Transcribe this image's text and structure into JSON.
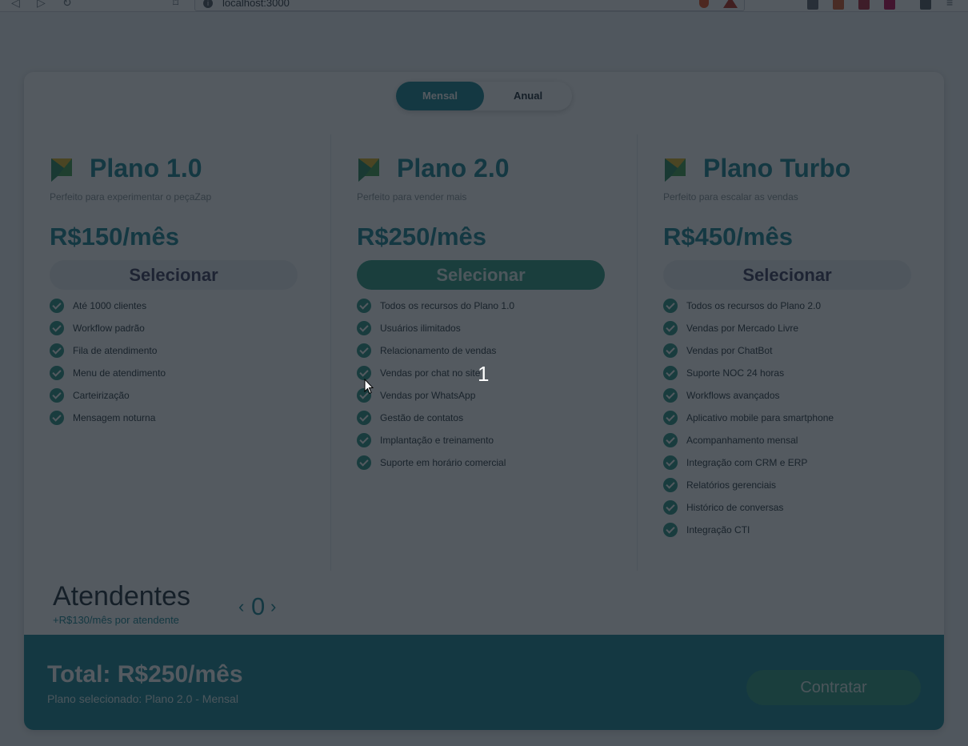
{
  "browser": {
    "url": "localhost:3000"
  },
  "billing_toggle": {
    "monthly_label": "Mensal",
    "annual_label": "Anual",
    "active": "Mensal"
  },
  "select_label": "Selecionar",
  "plans": [
    {
      "name": "Plano 1.0",
      "subtitle": "Perfeito para experimentar o peçaZap",
      "price": "R$150/mês",
      "selected": false,
      "features": [
        "Até 1000 clientes",
        "Workflow padrão",
        "Fila de atendimento",
        "Menu de atendimento",
        "Carteirização",
        "Mensagem noturna"
      ]
    },
    {
      "name": "Plano 2.0",
      "subtitle": "Perfeito para vender mais",
      "price": "R$250/mês",
      "selected": true,
      "features": [
        "Todos os recursos do Plano 1.0",
        "Usuários ilimitados",
        "Relacionamento de vendas",
        "Vendas por chat no site",
        "Vendas por WhatsApp",
        "Gestão de contatos",
        "Implantação e treinamento",
        "Suporte em horário comercial"
      ]
    },
    {
      "name": "Plano Turbo",
      "subtitle": "Perfeito para escalar as vendas",
      "price": "R$450/mês",
      "selected": false,
      "features": [
        "Todos os recursos do Plano 2.0",
        "Vendas por Mercado Livre",
        "Vendas por ChatBot",
        "Suporte NOC 24 horas",
        "Workflows avançados",
        "Aplicativo mobile para smartphone",
        "Acompanhamento mensal",
        "Integração com CRM e ERP",
        "Relatórios gerenciais",
        "Histórico de conversas",
        "Integração CTI"
      ]
    }
  ],
  "attendants": {
    "title": "Atendentes",
    "price_note": "+R$130/mês por atendente",
    "count": "0",
    "decrement": "‹",
    "increment": "›"
  },
  "footer": {
    "total": "Total: R$250/mês",
    "selected_plan": "Plano selecionado: Plano 2.0 - Mensal",
    "contract_label": "Contratar"
  },
  "overlay": {
    "step_number": "1"
  },
  "colors": {
    "brand": "#2b8d99",
    "check": "#3b9b8c",
    "selected_button": "#3fa08a"
  }
}
